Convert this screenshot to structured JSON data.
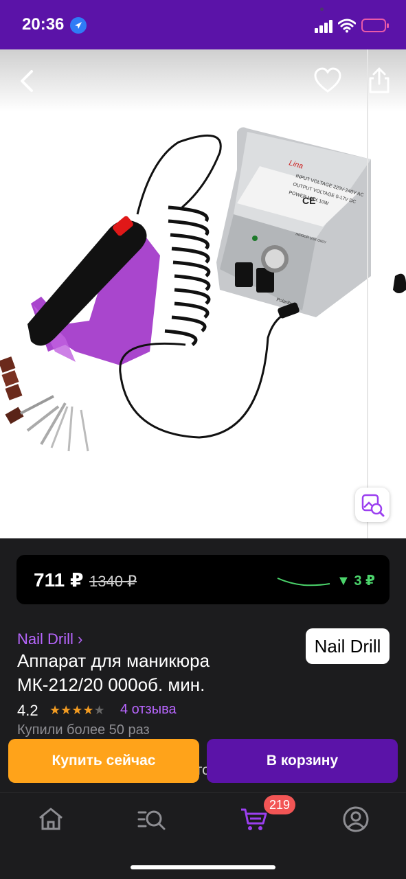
{
  "status_bar": {
    "time": "20:36"
  },
  "gallery": {
    "product_image_alt": "nail drill device photo",
    "image_brand_text": "Lina",
    "image_panel_lines": [
      "INPUT VOLTAGE 220V-240V AC",
      "OUTPUT VOLTAGE 0-17V DC",
      "POWER MAX 10W"
    ],
    "image_ce_mark": "CE",
    "image_indoor_text": "INDOOR USE ONLY",
    "image_polarity_text": "Polarity"
  },
  "price": {
    "current": "711 ₽",
    "old": "1340 ₽",
    "drop": "▼ 3 ₽",
    "drop_color": "#4bd46b"
  },
  "product": {
    "brand_link": "Nail Drill ›",
    "brand_logo_text": "Nail Drill",
    "title": "Аппарат для маникюра МК-212/20 000об. мин.",
    "rating": "4.2",
    "rating_stars": 4.2,
    "rating_stars_full": "★★★★",
    "rating_stars_empty": "★",
    "reviews": "4 отзыва",
    "purchased": "Купили более 50 раз",
    "description_partial": "и высокого качества, с долговечным сроком"
  },
  "actions": {
    "buy_now": "Купить сейчас",
    "add_to_cart": "В корзину"
  },
  "tab_bar": {
    "cart_badge": "219",
    "tabs": [
      "home-icon",
      "catalog-search-icon",
      "cart-icon",
      "profile-icon"
    ],
    "active_color": "#9b3ff0"
  },
  "colors": {
    "accent_purple": "#5b13a8",
    "orange": "#ffa31a",
    "link_purple": "#b866ff"
  }
}
